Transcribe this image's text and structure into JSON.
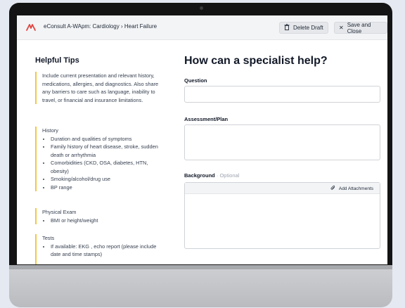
{
  "header": {
    "app_title": "eConsult A-WApm: Cardiology › Heart Failure",
    "delete_label": "Delete Draft",
    "save_label": "Save and Close",
    "brand_color": "#e0443e"
  },
  "tips": {
    "title": "Helpful Tips",
    "intro": "Include current presentation and relevant history, medications, allergies, and diagnostics. Also share any barriers to care such as language, inability to travel, or financial and insurance limitations.",
    "history": {
      "heading": "History",
      "items": [
        "Duration and qualities of symptoms",
        "Family history of heart disease, stroke, sudden death or arrhythmia",
        "Comorbidities (CKD, OSA, diabetes, HTN, obesity)",
        "Smoking/alcohol/drug use",
        "BP range"
      ]
    },
    "exam": {
      "heading": "Physical Exam",
      "items": [
        "BMI or height/weight"
      ]
    },
    "tests": {
      "heading": "Tests",
      "items": [
        "If available: EKG , echo report (please include date and time stamps)"
      ]
    }
  },
  "form": {
    "title": "How can a specialist help?",
    "question_label": "Question",
    "assessment_label": "Assessment/Plan",
    "background_label": "Background",
    "background_optional": "· Optional",
    "attach_label": "Add Attachments"
  }
}
